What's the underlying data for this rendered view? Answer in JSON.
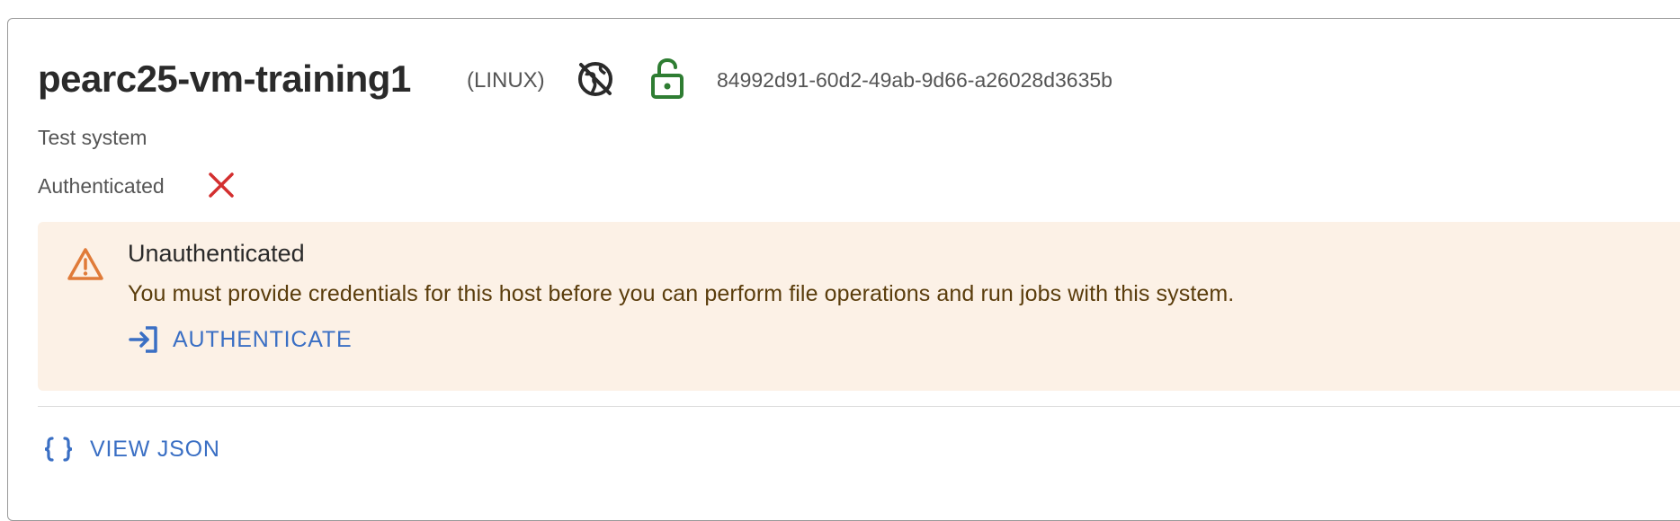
{
  "system": {
    "name": "pearc25-vm-training1",
    "os": "(LINUX)",
    "uuid": "84992d91-60d2-49ab-9d66-a26028d3635b",
    "description": "Test system",
    "authenticated_label": "Authenticated",
    "authenticated_icon": "close-icon",
    "visibility_icon": "public-off-globe-icon",
    "lock_icon": "lock-open-icon"
  },
  "alert": {
    "title": "Unauthenticated",
    "message": "You must provide credentials for this host before you can perform file operations and run jobs with this system.",
    "action_label": "AUTHENTICATE",
    "icon": "warning-icon"
  },
  "actions": {
    "view_json_label": "VIEW JSON",
    "view_json_icon": "braces-icon"
  },
  "colors": {
    "accent": "#3a6fc4",
    "warning_bg": "#fcf1e6",
    "warning_icon": "#e07b39",
    "error": "#d32f2f",
    "success": "#2e7d32"
  }
}
